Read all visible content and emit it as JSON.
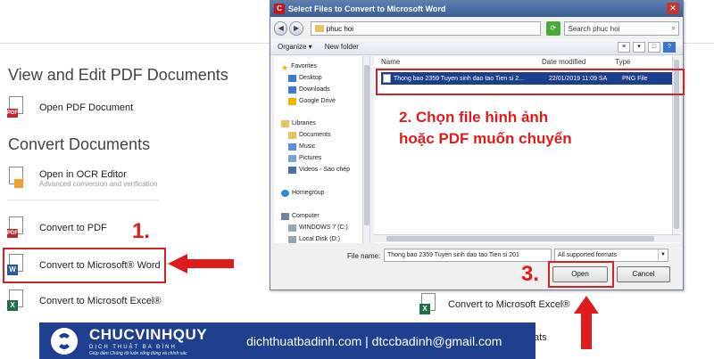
{
  "left": {
    "section1_title": "View and Edit PDF Documents",
    "open_pdf": "Open PDF Document",
    "section2_title": "Convert Documents",
    "ocr_editor": "Open in OCR Editor",
    "ocr_sub": "Advanced conversion and verification",
    "convert_pdf": "Convert to PDF",
    "convert_word": "Convert to Microsoft® Word",
    "convert_excel": "Convert to Microsoft Excel®",
    "fats_fragment": "ats"
  },
  "steps": {
    "s1": "1.",
    "s2": "2.  Chọn file hình ảnh",
    "s2b": "hoặc PDF muốn chuyển",
    "s3": "3."
  },
  "dialog": {
    "title": "Select Files to Convert to Microsoft Word",
    "path": "phuc hoi",
    "search_placeholder": "Search phuc hoi",
    "organize": "Organize ▾",
    "new_folder": "New folder",
    "columns": {
      "name": "Name",
      "date": "Date modified",
      "type": "Type"
    },
    "nav": [
      "Favorites",
      "Desktop",
      "Downloads",
      "Google Drive",
      "Libraries",
      "Documents",
      "Music",
      "Pictures",
      "Videos - Sao chép",
      "Homegroup",
      "Computer",
      "WINDOWS 7 (C:)",
      "Local Disk (D:)"
    ],
    "file": {
      "name": "Thong bao 2359 Tuyen sinh dao tao Tien si 2...",
      "date": "22/01/2019 11:09 SA",
      "type": "PNG File"
    },
    "file_name_label": "File name:",
    "file_name_value": "Thong bao 2359 Tuyen sinh dao tao Tien si 201",
    "format": "All supported formats",
    "open": "Open",
    "cancel": "Cancel"
  },
  "banner": {
    "brand": "CHUCVINHQUY",
    "sub": "DỊCH THUẬT BA ĐÌNH",
    "tagline": "Giúp đảm Chúng tôi luôn sống đúng và chính xác",
    "contact": "dichthuatbadinh.com | dtccbadinh@gmail.com"
  },
  "colors": {
    "accent_red": "#d32222",
    "banner": "#1f3f8f",
    "selection": "#1c3f8c"
  }
}
